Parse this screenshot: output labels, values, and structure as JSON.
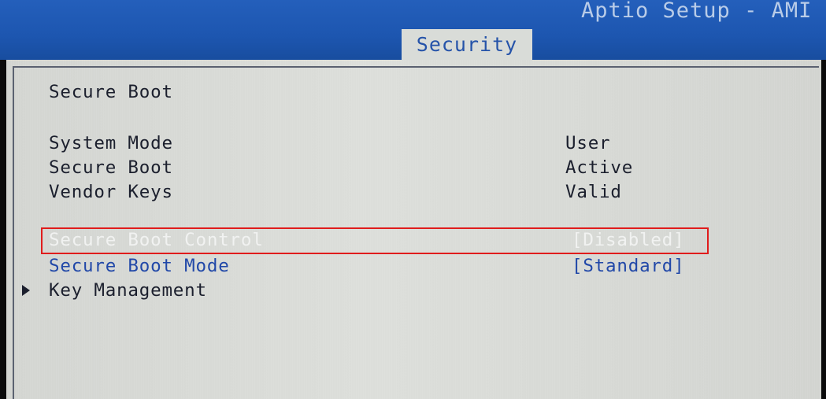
{
  "header": {
    "title": "Aptio Setup - AMI",
    "active_tab": "Security"
  },
  "section": {
    "title": "Secure Boot"
  },
  "status_rows": [
    {
      "label": "System Mode",
      "value": "User"
    },
    {
      "label": "Secure Boot",
      "value": "Active"
    },
    {
      "label": "Vendor Keys",
      "value": "Valid"
    }
  ],
  "options": [
    {
      "label": "Secure Boot Control",
      "value": "[Disabled]",
      "selected": true
    },
    {
      "label": "Secure Boot Mode",
      "value": "[Standard]",
      "selected": false
    }
  ],
  "submenu": {
    "label": "Key Management",
    "icon": "submenu-arrow-icon"
  },
  "colors": {
    "header_blue": "#1d56b0",
    "panel_gray": "#d9dcd8",
    "option_blue": "#2148a8",
    "selected_text": "#f1f2f1",
    "highlight_red": "#e01c1c"
  }
}
